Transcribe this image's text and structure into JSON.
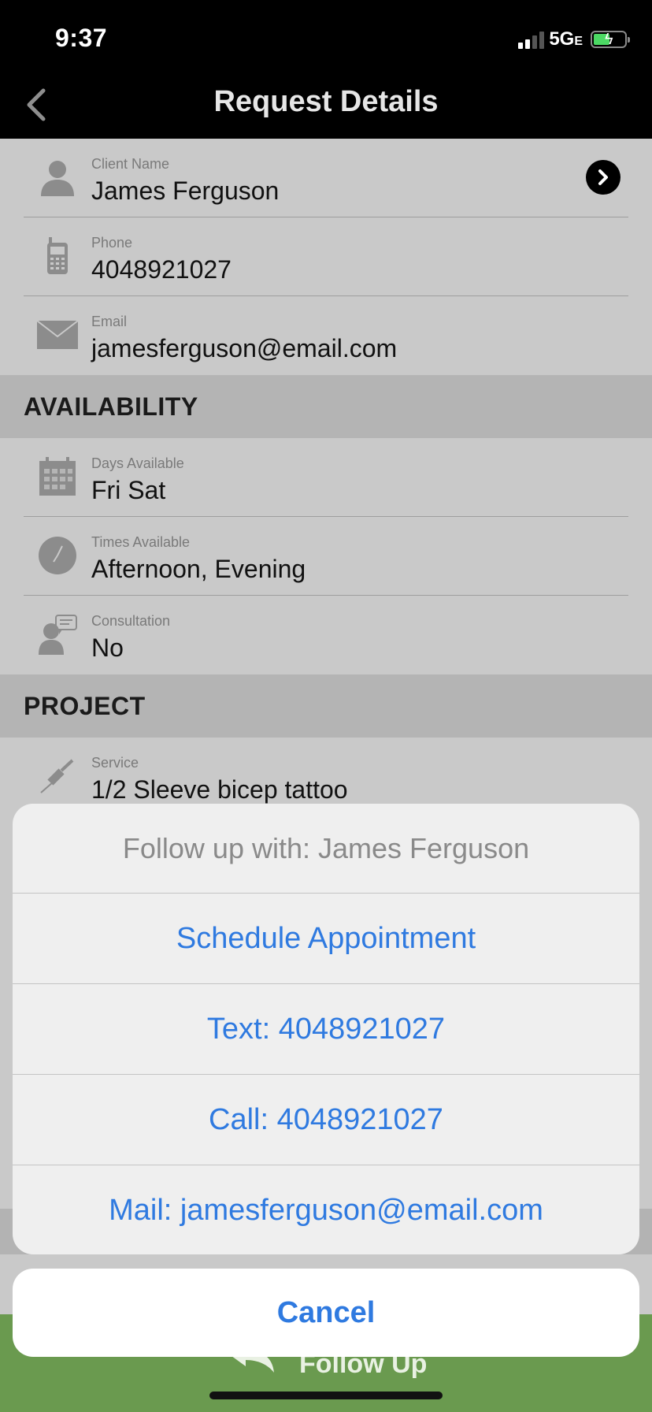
{
  "status_bar": {
    "time": "9:37",
    "network": "5G",
    "network_suffix": "E"
  },
  "nav": {
    "title": "Request Details"
  },
  "contact": [
    {
      "label": "Client Name",
      "value": "James Ferguson"
    },
    {
      "label": "Phone",
      "value": "4048921027"
    },
    {
      "label": "Email",
      "value": "jamesferguson@email.com"
    }
  ],
  "availability": {
    "header": "AVAILABILITY",
    "rows": [
      {
        "label": "Days Available",
        "value": "Fri Sat"
      },
      {
        "label": "Times Available",
        "value": "Afternoon, Evening"
      },
      {
        "label": "Consultation",
        "value": "No"
      }
    ]
  },
  "project": {
    "header": "PROJECT",
    "rows": [
      {
        "label": "Service",
        "value": "1/2 Sleeve bicep tattoo"
      }
    ]
  },
  "action_sheet": {
    "title": "Follow up with: James Ferguson",
    "items": [
      "Schedule Appointment",
      "Text: 4048921027",
      "Call: 4048921027",
      "Mail: jamesferguson@email.com"
    ],
    "cancel": "Cancel"
  },
  "footer": {
    "follow_up_label": "Follow Up"
  },
  "colors": {
    "accent_blue": "#2f7ae0",
    "footer_green": "#6a9a4f",
    "battery_green": "#4cd964"
  },
  "icons": [
    "chevron-left-icon",
    "person-icon",
    "phone-icon",
    "envelope-icon",
    "calendar-icon",
    "clock-icon",
    "consultation-icon",
    "tattoo-machine-icon",
    "chevron-right-icon",
    "reply-icon"
  ]
}
